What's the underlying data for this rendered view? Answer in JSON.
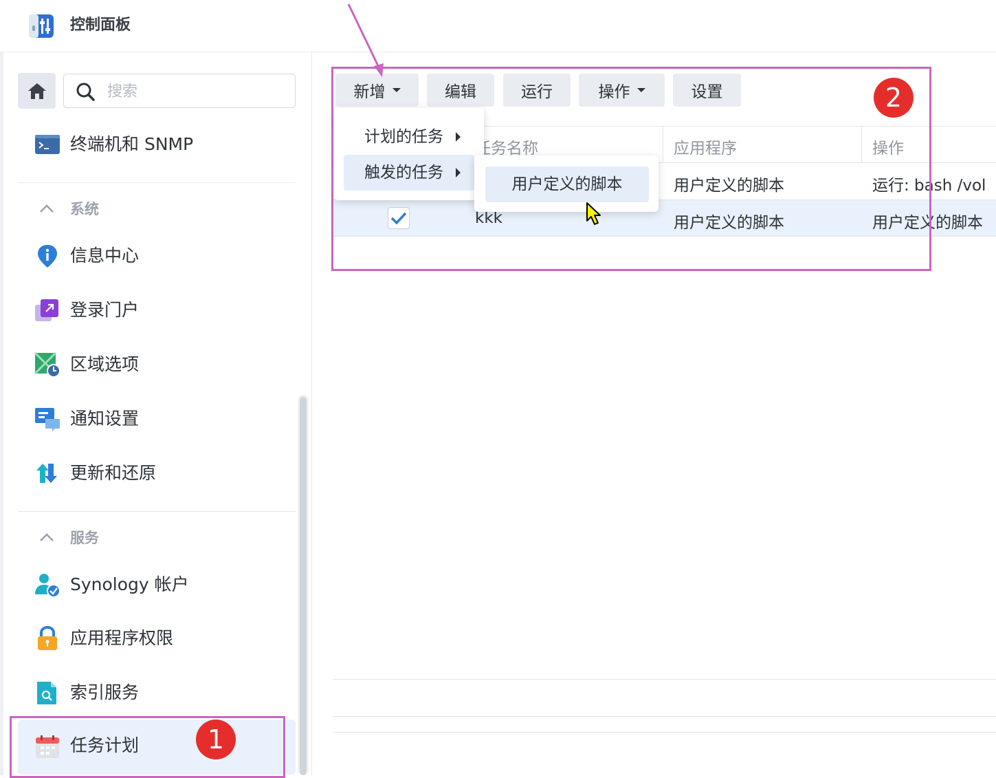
{
  "window": {
    "title": "控制面板"
  },
  "sidebar": {
    "search_placeholder": "搜索",
    "items_top": [
      {
        "label": "终端机和 SNMP",
        "icon": "terminal-icon"
      }
    ],
    "system_section": {
      "label": "系统",
      "items": [
        {
          "label": "信息中心",
          "icon": "info-center-icon"
        },
        {
          "label": "登录门户",
          "icon": "login-portal-icon"
        },
        {
          "label": "区域选项",
          "icon": "regional-options-icon"
        },
        {
          "label": "通知设置",
          "icon": "notification-icon"
        },
        {
          "label": "更新和还原",
          "icon": "update-restore-icon"
        }
      ]
    },
    "services_section": {
      "label": "服务",
      "items": [
        {
          "label": "Synology 帐户",
          "icon": "synology-account-icon"
        },
        {
          "label": "应用程序权限",
          "icon": "app-privileges-icon"
        },
        {
          "label": "索引服务",
          "icon": "indexing-service-icon"
        },
        {
          "label": "任务计划",
          "icon": "task-scheduler-icon",
          "selected": true
        }
      ]
    }
  },
  "toolbar": {
    "create_label": "新增",
    "edit_label": "编辑",
    "run_label": "运行",
    "action_label": "操作",
    "settings_label": "设置"
  },
  "grid": {
    "columns": [
      "任务名称",
      "应用程序",
      "操作"
    ],
    "rows": [
      {
        "enabled": false,
        "name": "",
        "app": "用户定义的脚本",
        "action": "运行: bash /vol"
      },
      {
        "enabled": true,
        "name": "kkk",
        "app": "用户定义的脚本",
        "action": "用户定义的脚本"
      }
    ]
  },
  "create_menu": {
    "items": [
      {
        "label": "计划的任务"
      },
      {
        "label": "触发的任务"
      }
    ],
    "submenu": {
      "items": [
        {
          "label": "用户定义的脚本"
        }
      ]
    }
  },
  "annotations": {
    "badge_1": "1",
    "badge_2": "2",
    "color": "#c965c1"
  },
  "colors": {
    "accent": "#2d7ed8",
    "selected_bg": "#e9f1fc",
    "badge": "#e52e2c"
  }
}
